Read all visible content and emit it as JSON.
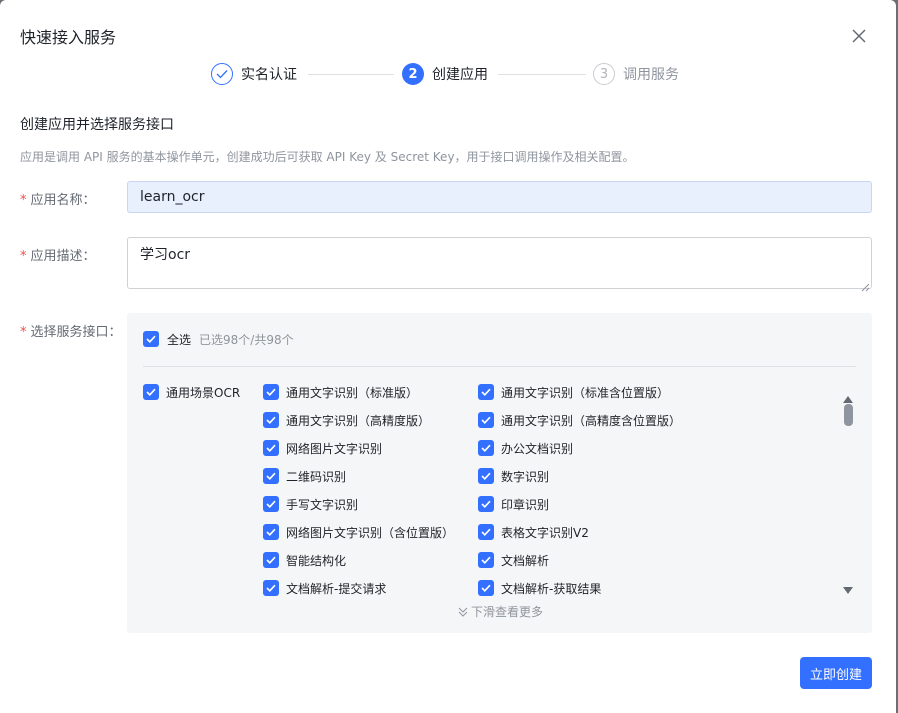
{
  "dialog": {
    "title": "快速接入服务"
  },
  "steps": [
    {
      "number": "1",
      "label": "实名认证",
      "status": "completed"
    },
    {
      "number": "2",
      "label": "创建应用",
      "status": "active"
    },
    {
      "number": "3",
      "label": "调用服务",
      "status": "pending"
    }
  ],
  "section": {
    "title": "创建应用并选择服务接口",
    "description": "应用是调用 API 服务的基本操作单元，创建成功后可获取 API Key 及 Secret Key，用于接口调用操作及相关配置。"
  },
  "form": {
    "name_label": "应用名称：",
    "name_value": "learn_ocr",
    "desc_label": "应用描述：",
    "desc_value": "学习ocr",
    "api_label": "选择服务接口："
  },
  "api_select": {
    "select_all_label": "全选",
    "count_text": "已选98个/共98个",
    "category": "通用场景OCR",
    "col1": [
      "通用文字识别（标准版）",
      "通用文字识别（高精度版）",
      "网络图片文字识别",
      "二维码识别",
      "手写文字识别",
      "网络图片文字识别（含位置版）",
      "智能结构化",
      "文档解析-提交请求"
    ],
    "col2": [
      "通用文字识别（标准含位置版）",
      "通用文字识别（高精度含位置版）",
      "办公文档识别",
      "数字识别",
      "印章识别",
      "表格文字识别V2",
      "文档解析",
      "文档解析-获取结果"
    ],
    "more_text": "下滑查看更多"
  },
  "buttons": {
    "create": "立即创建"
  },
  "colors": {
    "primary": "#3370ff",
    "required": "#f54a45"
  }
}
